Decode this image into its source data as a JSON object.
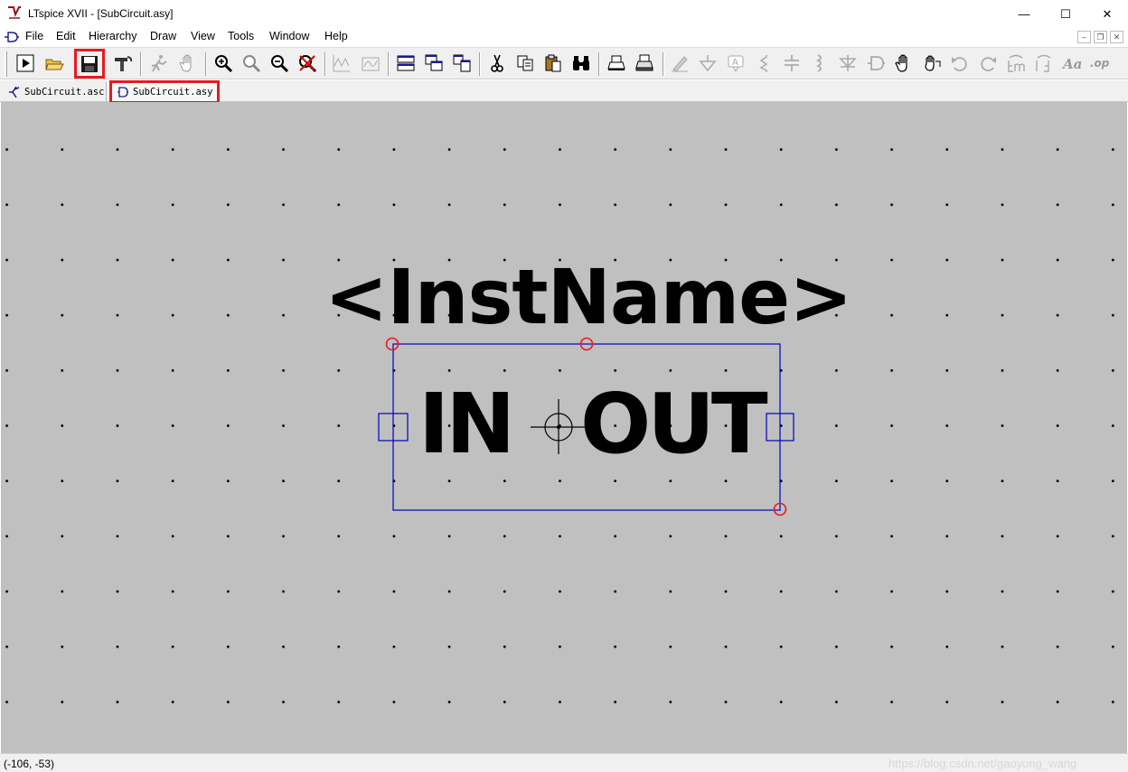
{
  "window": {
    "title": "LTspice XVII - [SubCircuit.asy]",
    "controls": {
      "minimize": "—",
      "maximize": "☐",
      "close": "✕"
    }
  },
  "menu": {
    "items": [
      "File",
      "Edit",
      "Hierarchy",
      "Draw",
      "View",
      "Tools",
      "Window",
      "Help"
    ],
    "mdi_controls": {
      "minimize": "–",
      "restore": "❐",
      "close": "✕"
    }
  },
  "toolbar": {
    "icons": [
      "run-icon",
      "open-icon",
      "save-icon",
      "control-panel-icon",
      "halt-icon",
      "pan-hand-icon",
      "zoom-in-icon",
      "zoom-fit-icon",
      "zoom-out-icon",
      "zoom-cancel-icon",
      "autorange-icon",
      "waveform-icon",
      "tile-horizontal-icon",
      "cascade-icon",
      "tile-vertical-icon",
      "cut-icon",
      "copy-icon",
      "paste-icon",
      "find-icon",
      "print-preview-icon",
      "print-icon",
      "wire-icon",
      "ground-icon",
      "label-net-icon",
      "resistor-icon",
      "capacitor-icon",
      "inductor-icon",
      "diode-icon",
      "component-icon",
      "move-icon",
      "drag-icon",
      "undo-icon",
      "redo-icon",
      "rotate-icon",
      "mirror-icon",
      "text-icon",
      "spice-directive-icon"
    ],
    "highlighted": "save-icon"
  },
  "tabs": [
    {
      "label": "SubCircuit.asc",
      "icon": "schematic-icon",
      "active": false
    },
    {
      "label": "SubCircuit.asy",
      "icon": "symbol-icon",
      "active": true,
      "highlighted": true
    }
  ],
  "symbol": {
    "inst_name": "<InstName>",
    "pin_in": "IN",
    "pin_out": "OUT"
  },
  "colors": {
    "canvas_bg": "#c0c0c0",
    "symbol_outline": "#0000c8",
    "pin_marker": "#0000c8",
    "selection_handle": "#e8191f",
    "highlight_box": "#e8191f"
  },
  "status": {
    "coords": "(-106, -53)",
    "watermark": "https://blog.csdn.net/gaoyong_wang"
  }
}
